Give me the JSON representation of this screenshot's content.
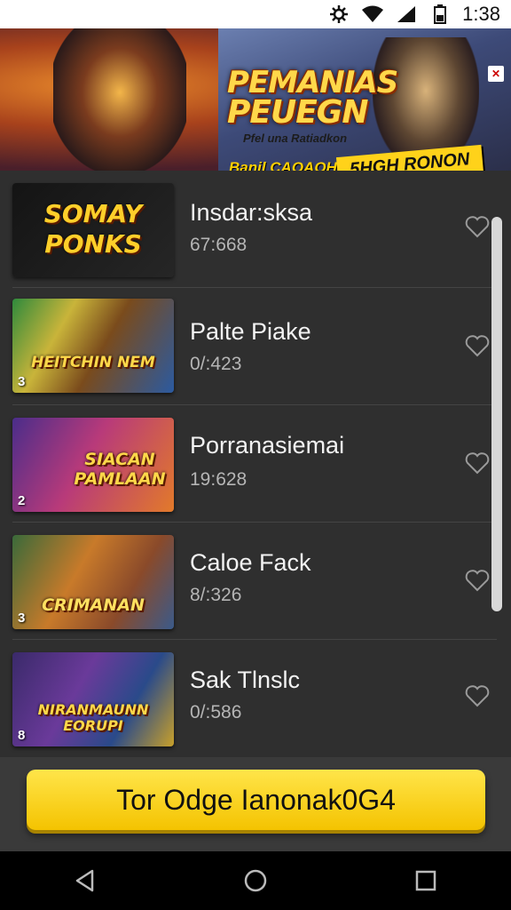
{
  "status_bar": {
    "time": "1:38",
    "icons": [
      "settings-icon",
      "wifi-icon",
      "signal-icon",
      "battery-icon"
    ]
  },
  "banner": {
    "title_line1": "PEMANIAS",
    "title_line2": "PEUEGN",
    "subtitle": "Pfel una Ratiadkon",
    "tagline": "Banil CAOAOH",
    "badge": "5HGH RONON",
    "close_label": "✕"
  },
  "list": {
    "items": [
      {
        "title": "Insdar:sksa",
        "count": "67:668",
        "thumb_text": "SOMAY PONKS",
        "rank": ""
      },
      {
        "title": "Palte Piake",
        "count": "0/:423",
        "thumb_text": "HEITCHIN NEM",
        "rank": "3"
      },
      {
        "title": "Porranasiemai",
        "count": "19:628",
        "thumb_text": "SIACAN PAMLAAN",
        "rank": "2"
      },
      {
        "title": "Caloe Fack",
        "count": "8/:326",
        "thumb_text": "CRIMANAN",
        "rank": "3"
      },
      {
        "title": "Sak Tlnslc",
        "count": "0/:586",
        "thumb_text": "NIRANMAUNN EORUPI",
        "rank": "8"
      }
    ]
  },
  "cta": {
    "label": "Tor Odge Ianonak0G4"
  },
  "colors": {
    "accent": "#f4c300",
    "background": "#2f2f2f"
  }
}
